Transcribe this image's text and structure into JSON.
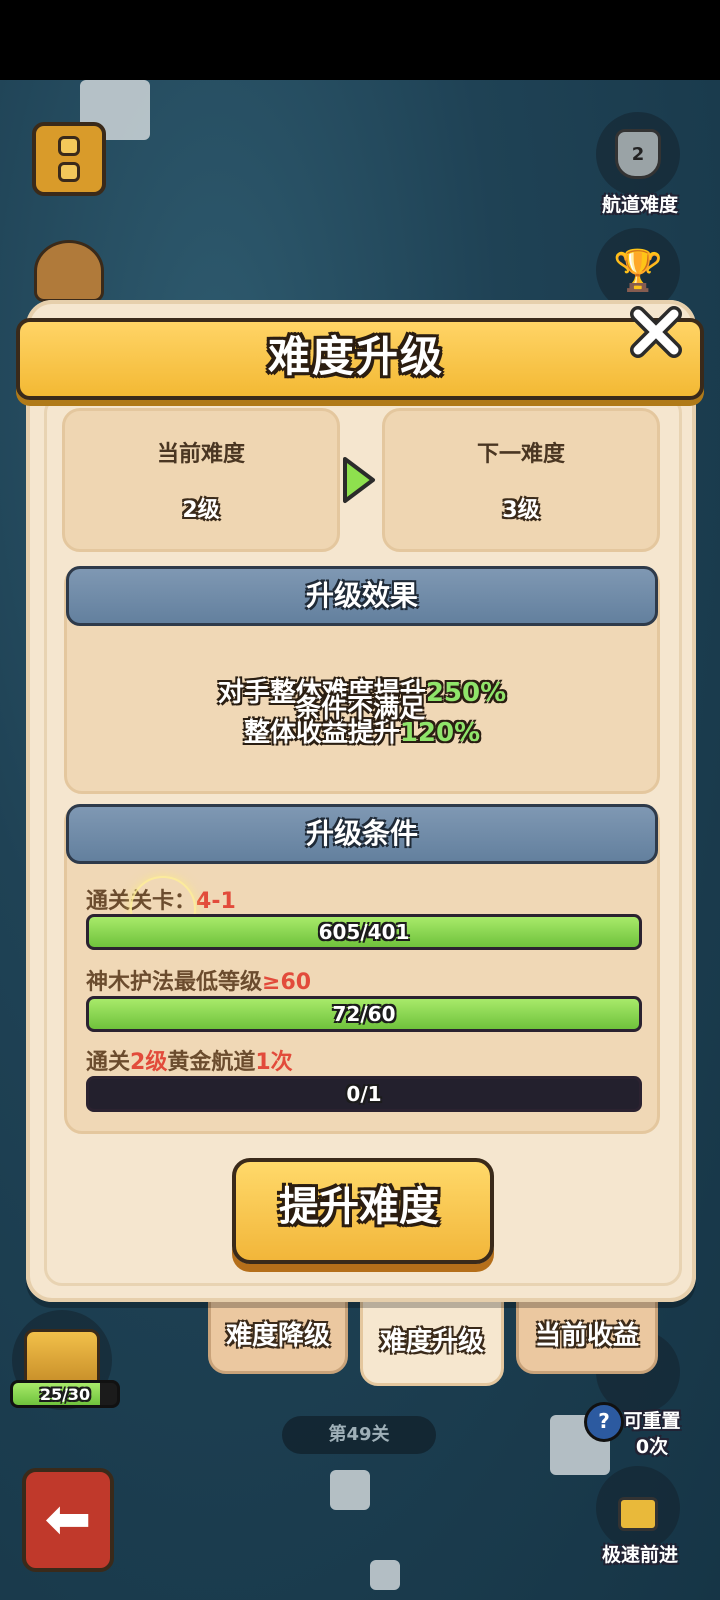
{
  "hud": {
    "route_difficulty_label": "航道难度",
    "route_difficulty_level": "2",
    "chest_progress": "25/30",
    "chest_progress_fraction": 0.833,
    "stage_label": "第49关",
    "reset_label": "可重置",
    "reset_count": "0次",
    "reset_help": "?",
    "speed_label": "极速前进"
  },
  "modal": {
    "title": "难度升级",
    "current": {
      "label": "当前难度",
      "value": "2级"
    },
    "next": {
      "label": "下一难度",
      "value": "3级"
    },
    "effect": {
      "header": "升级效果",
      "line1_text": "对手整体难度提升",
      "line1_value": "250%",
      "line2_text": "整体收益提升",
      "line2_value": "120%"
    },
    "toast": "条件不满足",
    "conditions": {
      "header": "升级条件",
      "items": [
        {
          "label": "通关关卡：",
          "highlight": "4-1",
          "progress": "605/401",
          "fill": 1.0
        },
        {
          "label": "神木护法最低等级",
          "highlight": "≥60",
          "progress": "72/60",
          "fill": 1.0
        },
        {
          "label_parts": [
            "通关",
            "2级",
            "黄金航道",
            "1次"
          ],
          "progress": "0/1",
          "fill": 0.0
        }
      ]
    },
    "upgrade_button": "提升难度"
  },
  "tabs": [
    "难度降级",
    "难度升级",
    "当前收益"
  ],
  "active_tab": 1,
  "colors": {
    "accent": "#f3b934",
    "green": "#8fe46a",
    "red": "#e24b3b",
    "header": "#6b86a3"
  }
}
